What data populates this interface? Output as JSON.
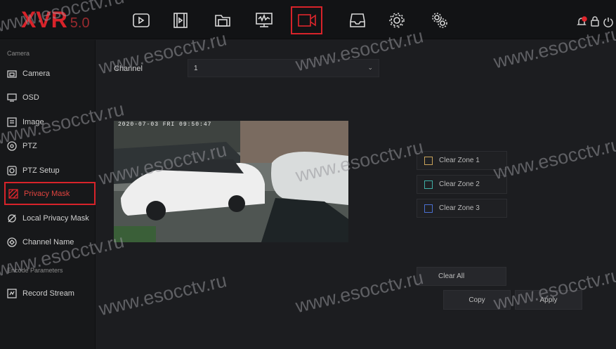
{
  "logo": {
    "main": "XVR",
    "version": "5.0"
  },
  "topnav": [
    {
      "name": "playback-icon"
    },
    {
      "name": "video-file-icon"
    },
    {
      "name": "folder-icon"
    },
    {
      "name": "network-monitor-icon"
    },
    {
      "name": "camera-icon"
    },
    {
      "name": "storage-icon"
    },
    {
      "name": "settings-gear-icon"
    },
    {
      "name": "system-gear-icon"
    }
  ],
  "right_icons": [
    "alarm-bell-icon",
    "lock-icon",
    "power-icon"
  ],
  "sidebar": {
    "section1_title": "Camera",
    "items": [
      {
        "label": "Camera",
        "icon": "camera-icon"
      },
      {
        "label": "OSD",
        "icon": "monitor-icon"
      },
      {
        "label": "Image",
        "icon": "image-icon"
      },
      {
        "label": "PTZ",
        "icon": "ptz-icon"
      },
      {
        "label": "PTZ Setup",
        "icon": "ptz-setup-icon"
      },
      {
        "label": "Privacy Mask",
        "icon": "privacy-mask-icon",
        "active": true
      },
      {
        "label": "Local Privacy Mask",
        "icon": "local-mask-icon"
      },
      {
        "label": "Channel Name",
        "icon": "channel-name-icon"
      }
    ],
    "section2_title": "Encode Parameters",
    "items2": [
      {
        "label": "Record Stream",
        "icon": "record-stream-icon"
      }
    ]
  },
  "main": {
    "channel_label": "Channel",
    "channel_value": "1",
    "osd_time": "2020-07-03 FRI 09:50:47",
    "zones": [
      {
        "label": "Clear Zone 1",
        "color": "#c9a35a"
      },
      {
        "label": "Clear Zone 2",
        "color": "#3fb0a6"
      },
      {
        "label": "Clear Zone 3",
        "color": "#4a6fd0"
      }
    ],
    "clear_all": "Clear All",
    "copy": "Copy",
    "apply": "Apply"
  },
  "watermark": "www.esocctv.ru",
  "colors": {
    "accent": "#d8232a",
    "bg": "#1c1d20"
  }
}
